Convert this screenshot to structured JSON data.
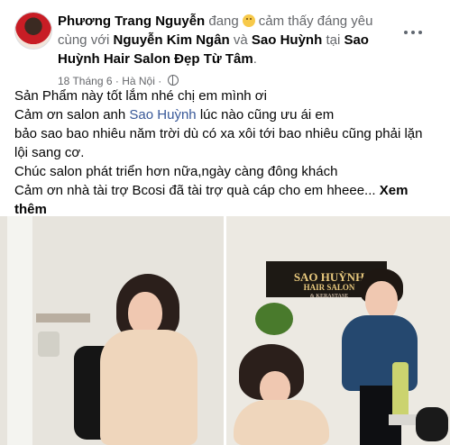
{
  "post": {
    "author_name": "Phương Trang Nguyễn",
    "feeling_prefix": "đang",
    "feeling_text": "cảm thấy đáng yêu",
    "with_text": "cùng với",
    "tag_1": "Nguyễn Kim Ngân",
    "and_text": "và",
    "tag_2": "Sao Huỳnh",
    "at_text": "tại",
    "place": "Sao Huỳnh Hair Salon Đẹp Từ Tâm",
    "period": ".",
    "date": "18 Tháng 6",
    "separator": "·",
    "location": "Hà Nội",
    "separator_2": "·"
  },
  "content": {
    "line_1": "Sản Phẩm này tốt lắm nhé chị em mình ơi",
    "line_2_prefix": "Cảm ơn salon anh",
    "line_2_link": "Sao Huỳnh",
    "line_2_suffix": "lúc nào cũng ưu ái em",
    "line_3": "bảo sao bao nhiêu năm trời dù có xa xôi tới bao nhiêu cũng phải lặn lội sang cơ.",
    "line_4": "Chúc salon phát triển hơn nữa,ngày càng đông khách",
    "line_5": "Cảm ơn nhà tài trợ Bcosi đã tài trợ quà cáp cho em hheee...",
    "see_more": "Xem thêm"
  },
  "photo_sign": {
    "line_1": "SAO HUỲNH",
    "line_2": "HAIR SALON",
    "line_3": "& KERASTASE"
  },
  "icons": {
    "avatar": "profile-avatar",
    "feeling": "smiling-face-icon",
    "privacy": "globe-icon",
    "menu": "more-options-icon"
  }
}
